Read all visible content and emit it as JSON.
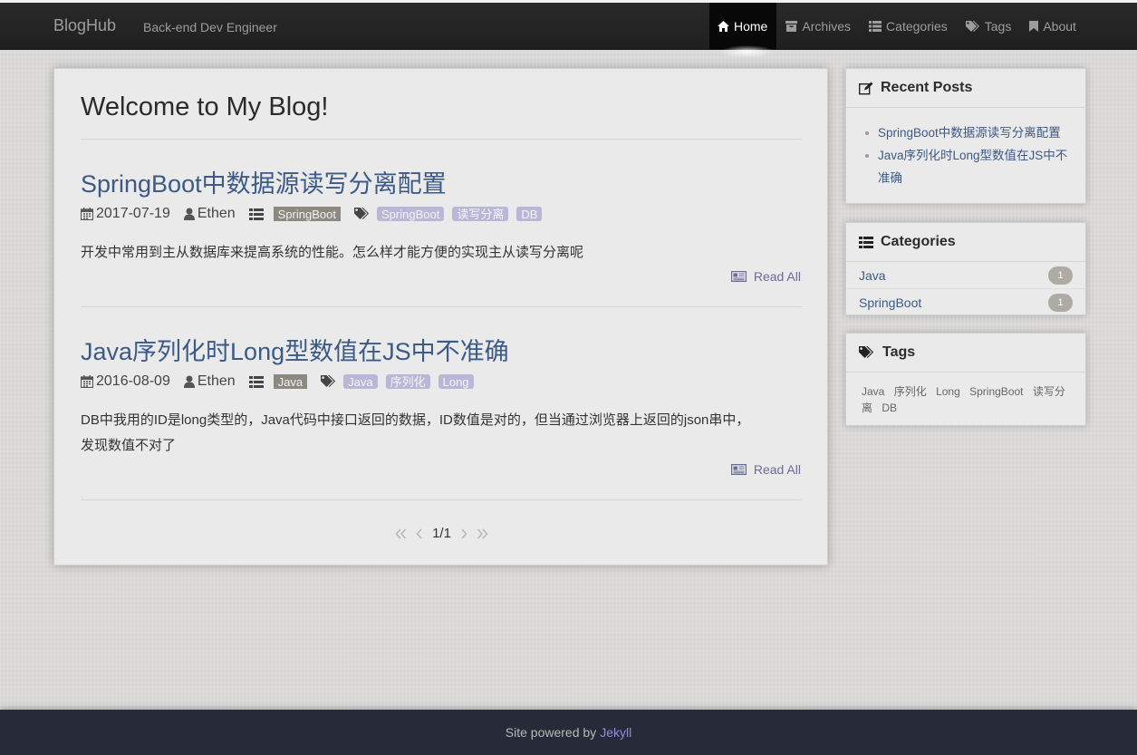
{
  "navbar": {
    "brand": "BlogHub",
    "subtitle": "Back-end Dev Engineer",
    "items": [
      {
        "label": "Home",
        "icon": "home-icon",
        "active": true
      },
      {
        "label": "Archives",
        "icon": "archive-icon"
      },
      {
        "label": "Categories",
        "icon": "list-icon"
      },
      {
        "label": "Tags",
        "icon": "tags-icon"
      },
      {
        "label": "About",
        "icon": "bookmark-icon"
      }
    ]
  },
  "main": {
    "title": "Welcome to My Blog!",
    "posts": [
      {
        "title": "SpringBoot中数据源读写分离配置",
        "date": "2017-07-19",
        "author": "Ethen",
        "category": "SpringBoot",
        "tags": [
          "SpringBoot",
          "读写分离",
          "DB"
        ],
        "excerpt": "开发中常用到主从数据库来提高系统的性能。怎么样才能方便的实现主从读写分离呢",
        "read_more": "Read All"
      },
      {
        "title": "Java序列化时Long型数值在JS中不准确",
        "date": "2016-08-09",
        "author": "Ethen",
        "category": "Java",
        "tags": [
          "Java",
          "序列化",
          "Long"
        ],
        "excerpt_line1": "DB中我用的ID是long类型的，Java代码中接口返回的数据，ID数值是对的，但当通过浏览器上返回的json串中，",
        "excerpt_line2": "发现数值不对了",
        "read_more": "Read All"
      }
    ],
    "pagination": {
      "current": "1/1"
    }
  },
  "sidebar": {
    "recent": {
      "title": "Recent Posts",
      "items": [
        "SpringBoot中数据源读写分离配置",
        "Java序列化时Long型数值在JS中不",
        "准确"
      ]
    },
    "categories": {
      "title": "Categories",
      "items": [
        {
          "name": "Java",
          "count": "1"
        },
        {
          "name": "SpringBoot",
          "count": "1"
        }
      ]
    },
    "tags": {
      "title": "Tags",
      "items": [
        "Java",
        "序列化",
        "Long",
        "SpringBoot",
        "读写分"
      ],
      "items_line2": [
        "离",
        "DB"
      ]
    }
  },
  "footer": {
    "text": "Site powered by",
    "link": "Jekyll"
  },
  "colors": {
    "link": "#3b5a86",
    "navbar": "#222222",
    "footer": "#272a38",
    "category_badge": "#8c8981",
    "tag_badge": "#b9b7d8"
  }
}
